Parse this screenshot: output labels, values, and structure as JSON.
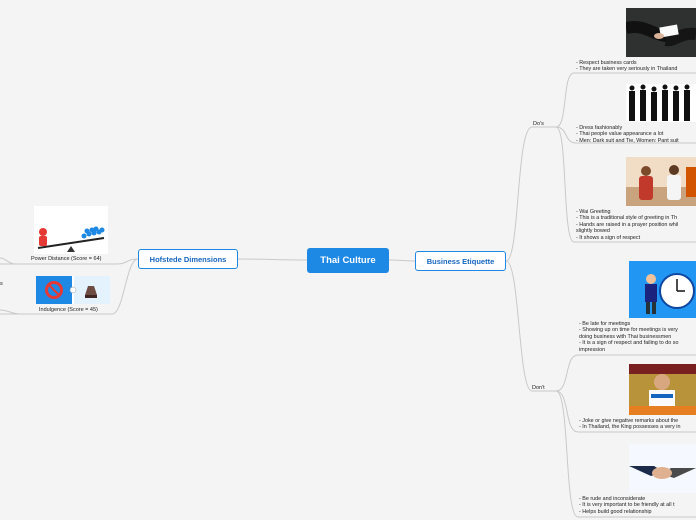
{
  "central": "Thai Culture",
  "left_branch": {
    "title": "Hofstede Dimensions",
    "power": "Power Distance (Score = 64)",
    "indulgence": "Indulgence (Score = 45)",
    "cut_label": "s"
  },
  "right_branch": {
    "title": "Business Etiquette",
    "dos": "Do's",
    "donts": "Don't",
    "do_items": [
      [
        "- Respect business cards",
        "- They are taken very seriously in Thailand"
      ],
      [
        "- Dress fashionably",
        "- Thai people value appearance a lot",
        "- Men: Dark suit and Tie, Women: Pant suit"
      ],
      [
        "- Wai Greeting",
        "- This is a traditional style of greeting in Th",
        "- Hands are raised in a prayer position whil",
        "slightly bowed",
        "- It shows a sign of respect"
      ]
    ],
    "dont_items": [
      [
        "- Be late for meetings",
        "- Showing up on time for meetings is very",
        "doing business with Thai businessmen",
        "- It is a sign of respect and failing to do so",
        "impression"
      ],
      [
        "- Joke or give negative remarks about the",
        "- In Thailand, the King possesses a very in"
      ],
      [
        "- Be rude and inconsiderate",
        "- It is very important to be friendly at all t",
        "- Helps build good relationship"
      ]
    ]
  },
  "colors": {
    "central": "#1e88e5",
    "line": "#c8c8c8",
    "main_border": "#1e88e5"
  }
}
